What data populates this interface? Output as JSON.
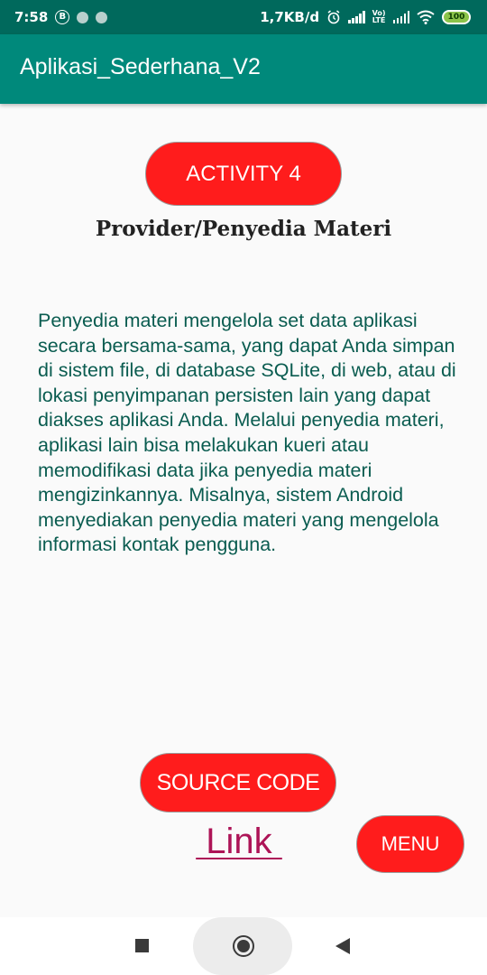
{
  "status_bar": {
    "time": "7:58",
    "b_badge": "B",
    "speed": "1,7KB/d",
    "lte_top": "Vo)",
    "lte_bottom": "LTE",
    "battery": "100"
  },
  "app_bar": {
    "title": "Aplikasi_Sederhana_V2"
  },
  "main": {
    "activity_button": "ACTIVITY 4",
    "heading": "Provider/Penyedia Materi",
    "description": "Penyedia materi mengelola set data aplikasi secara bersama-sama, yang dapat Anda simpan di sistem file, di database SQLite, di web, atau di lokasi penyimpanan persisten lain yang dapat diakses aplikasi Anda. Melalui penyedia materi, aplikasi lain bisa melakukan kueri atau memodifikasi data jika penyedia materi mengizinkannya. Misalnya, sistem Android menyediakan penyedia materi yang mengelola informasi kontak pengguna.",
    "source_code_button": "SOURCE CODE",
    "link_text": " Link ",
    "menu_button": "MENU"
  },
  "colors": {
    "status_bar": "#00695c",
    "app_bar": "#00897b",
    "button": "#ff1c1c",
    "description_text": "#0a5c50",
    "link": "#ad1457"
  },
  "icons": {
    "status": [
      "b-badge-icon",
      "notification-dot-icon",
      "alarm-icon",
      "signal-icon",
      "lte-icon",
      "wifi-icon",
      "battery-icon"
    ],
    "nav": [
      "recent-apps-icon",
      "home-icon",
      "back-icon"
    ]
  }
}
